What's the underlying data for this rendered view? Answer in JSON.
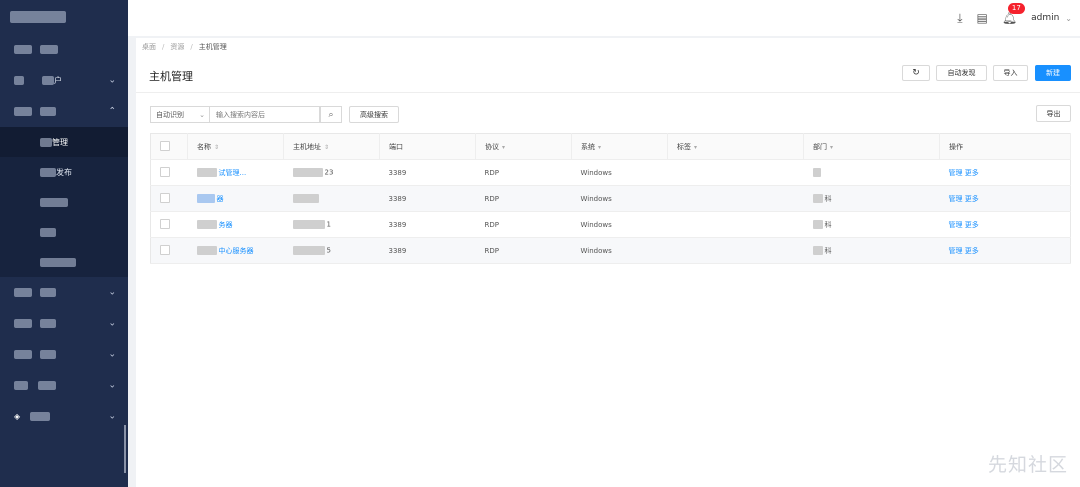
{
  "header": {
    "notification_count": "17",
    "user": "admin"
  },
  "sidebar": {
    "items": [
      {
        "label": ""
      },
      {
        "label": "户"
      },
      {
        "label": ""
      },
      {
        "label": "管理"
      },
      {
        "label": "发布"
      },
      {
        "label": ""
      },
      {
        "label": ""
      },
      {
        "label": ""
      },
      {
        "label": ""
      },
      {
        "label": ""
      },
      {
        "label": ""
      },
      {
        "label": ""
      },
      {
        "label": ""
      }
    ]
  },
  "breadcrumb": [
    "桌面",
    "资源",
    "主机管理"
  ],
  "page": {
    "title": "主机管理"
  },
  "toolbar": {
    "auto_discover": "自动发现",
    "import": "导入",
    "new": "新建",
    "export": "导出",
    "advanced_search": "高级搜索"
  },
  "search": {
    "select_value": "自动识别",
    "placeholder": "输入搜索内容后"
  },
  "table": {
    "headers": [
      "名称",
      "主机地址",
      "端口",
      "协议",
      "系统",
      "标签",
      "部门",
      "操作"
    ],
    "rows": [
      {
        "name": "试管理...",
        "address": "23",
        "port": "3389",
        "protocol": "RDP",
        "system": "Windows",
        "tag": "",
        "dept": "",
        "op1": "管理",
        "op2": "更多"
      },
      {
        "name": "器",
        "address": "",
        "port": "3389",
        "protocol": "RDP",
        "system": "Windows",
        "tag": "",
        "dept": "科",
        "op1": "管理",
        "op2": "更多"
      },
      {
        "name": "务器",
        "address": "1",
        "port": "3389",
        "protocol": "RDP",
        "system": "Windows",
        "tag": "",
        "dept": "科",
        "op1": "管理",
        "op2": "更多"
      },
      {
        "name": "中心服务器",
        "address": "5",
        "port": "3389",
        "protocol": "RDP",
        "system": "Windows",
        "tag": "",
        "dept": "科",
        "op1": "管理",
        "op2": "更多"
      }
    ]
  },
  "watermark": "先知社区",
  "colors": {
    "sidebar": "#1f2d4d",
    "primary": "#1890ff",
    "badge": "#f5222d"
  }
}
